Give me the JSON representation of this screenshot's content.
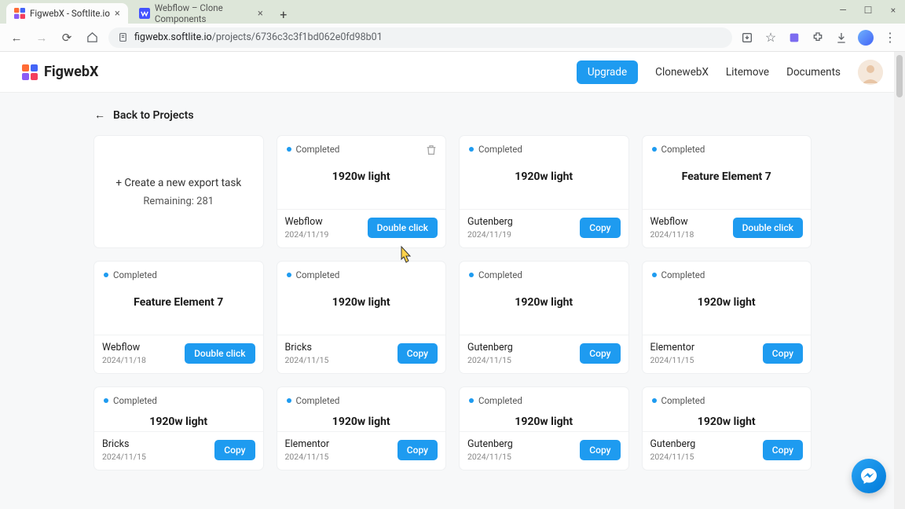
{
  "browser": {
    "tab1_title": "FigwebX - Softlite.io",
    "tab2_title": "Webflow – Clone Components",
    "url_host": "figwebx.softlite.io",
    "url_path": "/projects/6736c3c3f1bd062e0fd98b01"
  },
  "nav": {
    "brand": "FigwebX",
    "upgrade": "Upgrade",
    "links": [
      "ClonewebX",
      "Litemove",
      "Documents"
    ]
  },
  "back_link": "Back to Projects",
  "new_task": {
    "title": "+ Create a new export task",
    "remaining": "Remaining: 281"
  },
  "button_labels": {
    "copy": "Copy",
    "double": "Double click"
  },
  "cards": [
    {
      "status": "Completed",
      "title": "1920w light",
      "platform": "Webflow",
      "date": "2024/11/19",
      "action": "double",
      "trash": true
    },
    {
      "status": "Completed",
      "title": "1920w light",
      "platform": "Gutenberg",
      "date": "2024/11/19",
      "action": "copy"
    },
    {
      "status": "Completed",
      "title": "Feature Element 7",
      "platform": "Webflow",
      "date": "2024/11/18",
      "action": "double"
    },
    {
      "status": "Completed",
      "title": "Feature Element 7",
      "platform": "Webflow",
      "date": "2024/11/18",
      "action": "double"
    },
    {
      "status": "Completed",
      "title": "1920w light",
      "platform": "Bricks",
      "date": "2024/11/15",
      "action": "copy"
    },
    {
      "status": "Completed",
      "title": "1920w light",
      "platform": "Gutenberg",
      "date": "2024/11/15",
      "action": "copy"
    },
    {
      "status": "Completed",
      "title": "1920w light",
      "platform": "Elementor",
      "date": "2024/11/15",
      "action": "copy"
    },
    {
      "status": "Completed",
      "title": "1920w light",
      "platform": "Bricks",
      "date": "2024/11/15",
      "action": "copy"
    },
    {
      "status": "Completed",
      "title": "1920w light",
      "platform": "Elementor",
      "date": "2024/11/15",
      "action": "copy"
    },
    {
      "status": "Completed",
      "title": "1920w light",
      "platform": "Gutenberg",
      "date": "2024/11/15",
      "action": "copy"
    },
    {
      "status": "Completed",
      "title": "1920w light",
      "platform": "Gutenberg",
      "date": "2024/11/15",
      "action": "copy"
    }
  ]
}
